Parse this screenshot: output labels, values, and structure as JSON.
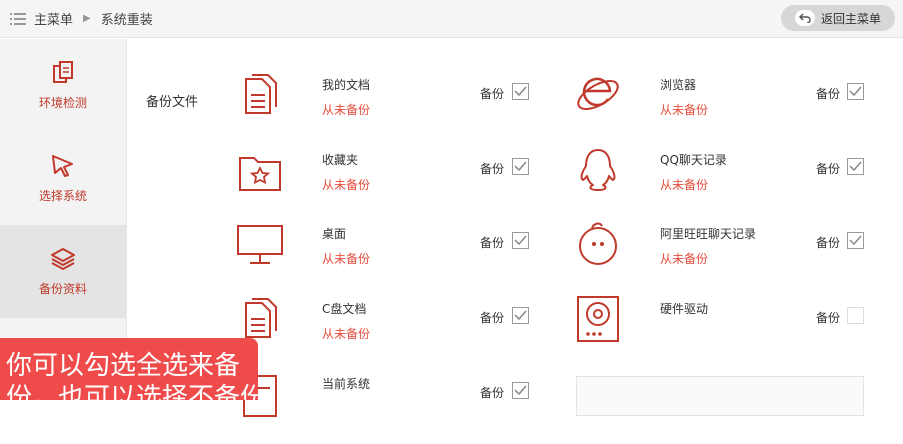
{
  "breadcrumb": {
    "root": "主菜单",
    "current": "系统重装"
  },
  "back_button": "返回主菜单",
  "sidebar": {
    "items": [
      {
        "label": "环境检测",
        "icon": "copy-icon"
      },
      {
        "label": "选择系统",
        "icon": "cursor-icon"
      },
      {
        "label": "备份资料",
        "icon": "layers-icon"
      }
    ]
  },
  "section_label": "备份文件",
  "backup_label": "备份",
  "left_items": [
    {
      "name": "我的文档",
      "status": "从未备份",
      "checked": true,
      "icon": "document-icon"
    },
    {
      "name": "收藏夹",
      "status": "从未备份",
      "checked": true,
      "icon": "folder-star-icon"
    },
    {
      "name": "桌面",
      "status": "从未备份",
      "checked": true,
      "icon": "monitor-icon"
    },
    {
      "name": "C盘文档",
      "status": "从未备份",
      "checked": true,
      "icon": "document-icon"
    },
    {
      "name": "当前系统",
      "status": "",
      "checked": true,
      "icon": "system-icon"
    }
  ],
  "right_items": [
    {
      "name": "浏览器",
      "status": "从未备份",
      "checked": true,
      "icon": "ie-icon"
    },
    {
      "name": "QQ聊天记录",
      "status": "从未备份",
      "checked": true,
      "icon": "qq-icon"
    },
    {
      "name": "阿里旺旺聊天记录",
      "status": "从未备份",
      "checked": true,
      "icon": "wangwang-icon"
    },
    {
      "name": "硬件驱动",
      "status": "",
      "checked": false,
      "icon": "driver-icon"
    }
  ],
  "overlay_text": {
    "line1": "你可以勾选全选来备",
    "line2": "份，也可以选择不备份"
  },
  "colors": {
    "accent": "#c0392b",
    "status_red": "#e74c3c",
    "overlay": "#ef4b4b"
  }
}
